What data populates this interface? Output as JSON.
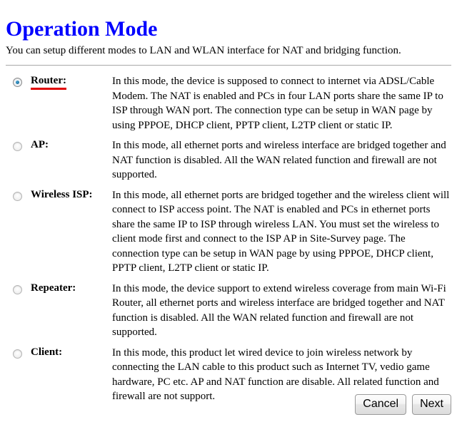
{
  "page": {
    "title": "Operation Mode",
    "intro": "You can setup different modes to LAN and WLAN interface for NAT and bridging function.",
    "title_color": "#0000ff",
    "underline_color": "#e00000",
    "divider_color": "#a8a8a8"
  },
  "modes": [
    {
      "id": "router",
      "label": "Router:",
      "selected": true,
      "underlined": true,
      "description": "In this mode, the device is supposed to connect to internet via ADSL/Cable Modem. The NAT is enabled and PCs in four LAN ports share the same IP to ISP through WAN port. The connection type can be setup in WAN page by using PPPOE, DHCP client, PPTP client, L2TP client or static IP."
    },
    {
      "id": "ap",
      "label": "AP:",
      "selected": false,
      "underlined": false,
      "description": "In this mode, all ethernet ports and wireless interface are bridged together and NAT function is disabled. All the WAN related function and firewall are not supported."
    },
    {
      "id": "wireless-isp",
      "label": "Wireless ISP:",
      "selected": false,
      "underlined": false,
      "description": "In this mode, all ethernet ports are bridged together and the wireless client will connect to ISP access point. The NAT is enabled and PCs in ethernet ports share the same IP to ISP through wireless LAN. You must set the wireless to client mode first and connect to the ISP AP in Site-Survey page. The connection type can be setup in WAN page by using PPPOE, DHCP client, PPTP client, L2TP client or static IP."
    },
    {
      "id": "repeater",
      "label": "Repeater:",
      "selected": false,
      "underlined": false,
      "description": "In this mode, the device support to extend wireless coverage from main Wi-Fi Router, all ethernet ports and wireless interface are bridged together and NAT function is disabled. All the WAN related function and firewall are not supported."
    },
    {
      "id": "client",
      "label": "Client:",
      "selected": false,
      "underlined": false,
      "description": "In this mode, this product let wired device to join wireless network by connecting the LAN cable to this product such as Internet TV, vedio game hardware, PC etc. AP and NAT function are disable. All related function and firewall are not support."
    }
  ],
  "buttons": {
    "cancel_label": "Cancel",
    "next_label": "Next"
  }
}
